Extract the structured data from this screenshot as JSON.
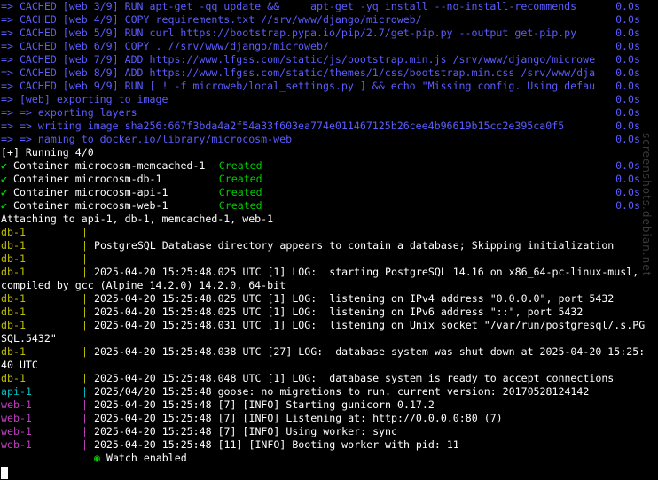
{
  "build_lines": [
    {
      "text": "=> CACHED [web 3/9] RUN apt-get -qq update &&     apt-get -yq install --no-install-recommends",
      "time": "0.0s"
    },
    {
      "text": "=> CACHED [web 4/9] COPY requirements.txt //srv/www/django/microweb/",
      "time": "0.0s"
    },
    {
      "text": "=> CACHED [web 5/9] RUN curl https://bootstrap.pypa.io/pip/2.7/get-pip.py --output get-pip.py",
      "time": "0.0s"
    },
    {
      "text": "=> CACHED [web 6/9] COPY . //srv/www/django/microweb/",
      "time": "0.0s"
    },
    {
      "text": "=> CACHED [web 7/9] ADD https://www.lfgss.com/static/js/bootstrap.min.js /srv/www/django/microwe",
      "time": "0.0s"
    },
    {
      "text": "=> CACHED [web 8/9] ADD https://www.lfgss.com/static/themes/1/css/bootstrap.min.css /srv/www/dja",
      "time": "0.0s"
    },
    {
      "text": "=> CACHED [web 9/9] RUN [ ! -f microweb/local_settings.py ] && echo \"Missing config. Using defau",
      "time": "0.0s"
    },
    {
      "text": "=> [web] exporting to image",
      "time": "0.0s"
    },
    {
      "text": "=> => exporting layers",
      "time": "0.0s"
    },
    {
      "text": "=> => writing image sha256:667f3bda4a2f54a33f603ea774e011467125b26cee4b96619b15cc2e395ca0f5",
      "time": "0.0s"
    },
    {
      "text": "=> => naming to docker.io/library/microcosm-web",
      "time": "0.0s"
    }
  ],
  "running_header": "[+] Running 4/0",
  "containers": [
    {
      "check": "✔",
      "label": "Container",
      "name": "microcosm-memcached-1",
      "status": "Created",
      "time": "0.0s"
    },
    {
      "check": "✔",
      "label": "Container",
      "name": "microcosm-db-1",
      "status": "Created",
      "time": "0.0s"
    },
    {
      "check": "✔",
      "label": "Container",
      "name": "microcosm-api-1",
      "status": "Created",
      "time": "0.0s"
    },
    {
      "check": "✔",
      "label": "Container",
      "name": "microcosm-web-1",
      "status": "Created",
      "time": "0.0s"
    }
  ],
  "attaching_line": "Attaching to api-1, db-1, memcached-1, web-1",
  "log_lines": [
    {
      "svc": "db-1",
      "color": "olive",
      "msg": ""
    },
    {
      "svc": "db-1",
      "color": "olive",
      "msg": "PostgreSQL Database directory appears to contain a database; Skipping initialization"
    },
    {
      "svc": "db-1",
      "color": "olive",
      "msg": ""
    },
    {
      "svc": "db-1",
      "color": "olive",
      "msg": "2025-04-20 15:25:48.025 UTC [1] LOG:  starting PostgreSQL 14.16 on x86_64-pc-linux-musl,"
    },
    {
      "svc": "",
      "color": "white",
      "msg": "compiled by gcc (Alpine 14.2.0) 14.2.0, 64-bit",
      "wrap": true
    },
    {
      "svc": "db-1",
      "color": "olive",
      "msg": "2025-04-20 15:25:48.025 UTC [1] LOG:  listening on IPv4 address \"0.0.0.0\", port 5432"
    },
    {
      "svc": "db-1",
      "color": "olive",
      "msg": "2025-04-20 15:25:48.025 UTC [1] LOG:  listening on IPv6 address \"::\", port 5432"
    },
    {
      "svc": "db-1",
      "color": "olive",
      "msg": "2025-04-20 15:25:48.031 UTC [1] LOG:  listening on Unix socket \"/var/run/postgresql/.s.PG"
    },
    {
      "svc": "",
      "color": "white",
      "msg": "SQL.5432\"",
      "wrap": true
    },
    {
      "svc": "db-1",
      "color": "olive",
      "msg": "2025-04-20 15:25:48.038 UTC [27] LOG:  database system was shut down at 2025-04-20 15:25:"
    },
    {
      "svc": "",
      "color": "white",
      "msg": "40 UTC",
      "wrap": true
    },
    {
      "svc": "db-1",
      "color": "olive",
      "msg": "2025-04-20 15:25:48.048 UTC [1] LOG:  database system is ready to accept connections"
    },
    {
      "svc": "api-1",
      "color": "cyan",
      "msg": "2025/04/20 15:25:48 goose: no migrations to run. current version: 20170528124142"
    },
    {
      "svc": "web-1",
      "color": "magenta",
      "msg": "2025-04-20 15:25:48 [7] [INFO] Starting gunicorn 0.17.2"
    },
    {
      "svc": "web-1",
      "color": "magenta",
      "msg": "2025-04-20 15:25:48 [7] [INFO] Listening at: http://0.0.0.0:80 (7)"
    },
    {
      "svc": "web-1",
      "color": "magenta",
      "msg": "2025-04-20 15:25:48 [7] [INFO] Using worker: sync"
    },
    {
      "svc": "web-1",
      "color": "magenta",
      "msg": "2025-04-20 15:25:48 [11] [INFO] Booting worker with pid: 11"
    }
  ],
  "watch": {
    "dot": "◉",
    "text": "Watch enabled"
  },
  "watermark": "screenshots.debian.net",
  "colors": {
    "background": "#000000",
    "build_text": "#5c5cff",
    "created": "#00cd00",
    "db": "#bfbf00",
    "api": "#00bfbf",
    "web": "#bf40bf"
  }
}
